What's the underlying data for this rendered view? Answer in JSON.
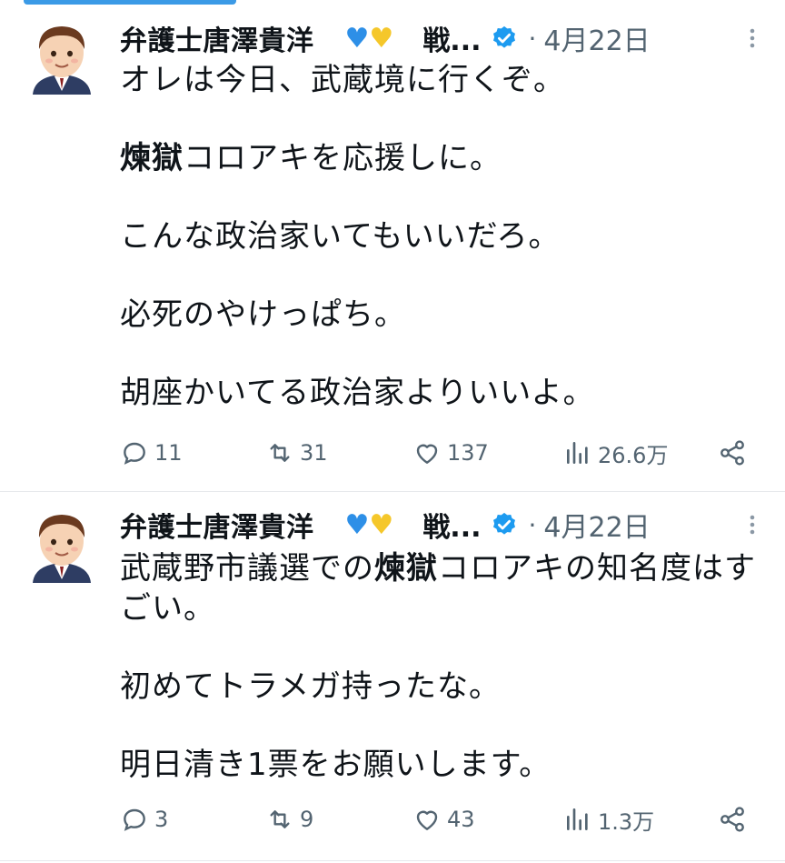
{
  "tweets": [
    {
      "author": "弁護士唐澤貴洋",
      "name_suffix": "戦...",
      "date": "4月22日",
      "body": {
        "p1": "オレは今日、武蔵境に行くぞ。",
        "p2_bold": "煉獄",
        "p2_rest": "コロアキを応援しに。",
        "p3": "こんな政治家いてもいいだろ。",
        "p4": "必死のやけっぱち。",
        "p5": "胡座かいてる政治家よりいいよ。"
      },
      "stats": {
        "replies": "11",
        "retweets": "31",
        "likes": "137",
        "views": "26.6万"
      }
    },
    {
      "author": "弁護士唐澤貴洋",
      "name_suffix": "戦...",
      "date": "4月22日",
      "body": {
        "p1_pre": "武蔵野市議選での",
        "p1_bold": "煉獄",
        "p1_rest": "コロアキの知名度はすごい。",
        "p2": "初めてトラメガ持ったな。",
        "p3": "明日清き1票をお願いします。"
      },
      "stats": {
        "replies": "3",
        "retweets": "9",
        "likes": "43",
        "views": "1.3万"
      }
    }
  ],
  "icons": [
    "avatar",
    "verified-badge-icon",
    "more-icon",
    "reply-icon",
    "retweet-icon",
    "like-icon",
    "views-icon",
    "share-icon"
  ],
  "colors": {
    "accent": "#1d9bf0",
    "muted": "#536471",
    "heart_blue": "#2d8fe7",
    "heart_yellow": "#f5c72a"
  }
}
